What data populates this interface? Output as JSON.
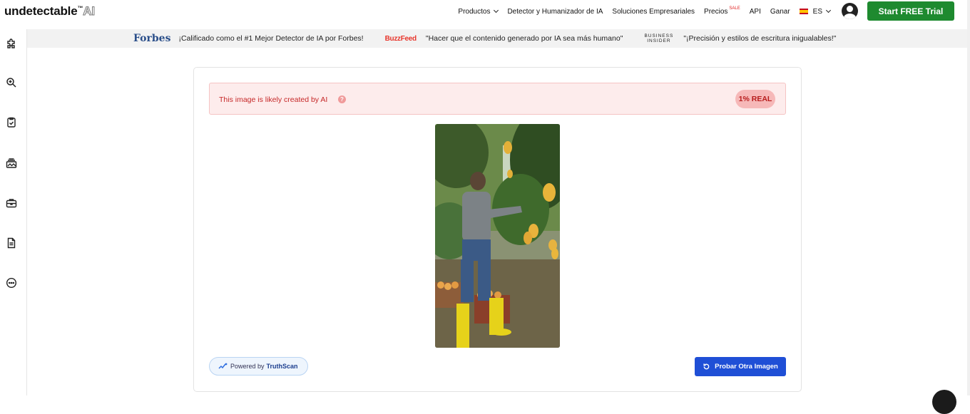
{
  "header": {
    "logo_text": "undetectable",
    "logo_tm": "™",
    "logo_ai": "AI",
    "nav": {
      "productos": "Productos",
      "detector": "Detector y Humanizador de IA",
      "soluciones": "Soluciones Empresariales",
      "precios": "Precios",
      "sale": "SALE",
      "api": "API",
      "ganar": "Ganar",
      "language": "ES"
    },
    "trial_button": "Start FREE Trial"
  },
  "press": {
    "forbes_logo": "Forbes",
    "forbes_quote": "¡Calificado como el #1 Mejor Detector de IA por Forbes!",
    "buzzfeed_logo": "BuzzFeed",
    "buzzfeed_quote": "\"Hacer que el contenido generado por IA sea más humano\"",
    "bi_logo_line1": "BUSINESS",
    "bi_logo_line2": "INSIDER",
    "bi_quote": "\"¡Precisión y estilos de escritura inigualables!\""
  },
  "sidebar": {
    "icons": [
      "puzzle-icon",
      "search-zoom-icon",
      "checklist-icon",
      "image-stack-icon",
      "briefcase-icon",
      "document-icon",
      "more-icon"
    ]
  },
  "result": {
    "message": "This image is likely created by AI",
    "help": "?",
    "badge": "1% REAL",
    "accent_color": "#c62828"
  },
  "footer_actions": {
    "powered_prefix": "Powered by",
    "powered_brand": "TruthScan",
    "retry_button": "Probar Otra Imagen"
  },
  "colors": {
    "trial_green": "#1e8a2f",
    "retry_blue": "#1f4fd6"
  }
}
